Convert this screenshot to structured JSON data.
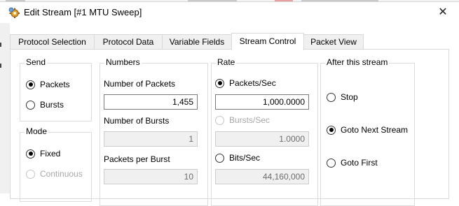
{
  "window": {
    "title": "Edit Stream [#1 MTU Sweep]",
    "close_glyph": "✕"
  },
  "tabs": [
    {
      "label": "Protocol Selection",
      "active": false
    },
    {
      "label": "Protocol Data",
      "active": false
    },
    {
      "label": "Variable Fields",
      "active": false
    },
    {
      "label": "Stream Control",
      "active": true
    },
    {
      "label": "Packet View",
      "active": false
    }
  ],
  "send": {
    "title": "Send",
    "options": [
      {
        "label": "Packets",
        "checked": true
      },
      {
        "label": "Bursts",
        "checked": false
      }
    ]
  },
  "mode": {
    "title": "Mode",
    "options": [
      {
        "label": "Fixed",
        "checked": true,
        "enabled": true
      },
      {
        "label": "Continuous",
        "checked": false,
        "enabled": false
      }
    ]
  },
  "numbers": {
    "title": "Numbers",
    "num_packets_label": "Number of Packets",
    "num_packets_value": "1,455",
    "num_bursts_label": "Number of Bursts",
    "num_bursts_value": "1",
    "packets_per_burst_label": "Packets per Burst",
    "packets_per_burst_value": "10"
  },
  "rate": {
    "title": "Rate",
    "packets_sec_label": "Packets/Sec",
    "packets_sec_value": "1,000.0000",
    "bursts_sec_label": "Bursts/Sec",
    "bursts_sec_value": "1.0000",
    "bits_sec_label": "Bits/Sec",
    "bits_sec_value": "44,160,000",
    "selected": "Packets/Sec"
  },
  "after": {
    "title": "After this stream",
    "options": [
      {
        "label": "Stop",
        "checked": false
      },
      {
        "label": "Goto Next Stream",
        "checked": true
      },
      {
        "label": "Goto First",
        "checked": false
      }
    ]
  },
  "colors": {
    "panel_border": "#d9d9d9",
    "disabled_text": "#a7a7a7",
    "disabled_field_bg": "#f0f0f0"
  },
  "icons": {
    "app": "gear-icon",
    "close": "close-icon"
  }
}
